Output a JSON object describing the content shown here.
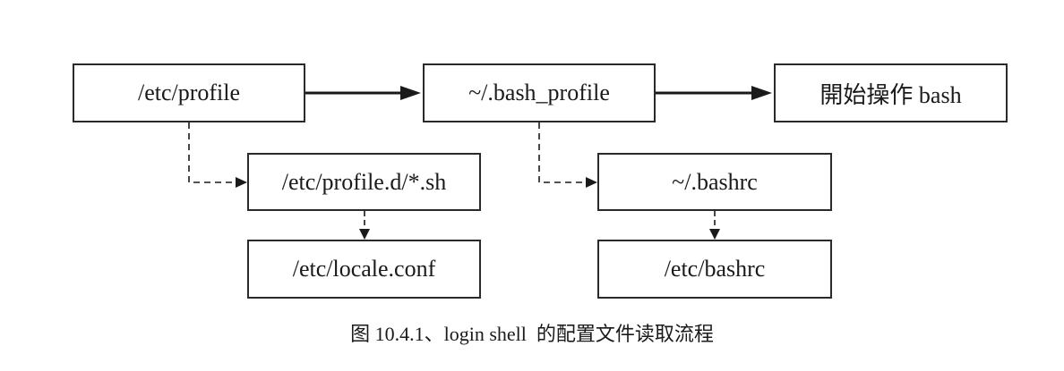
{
  "nodes": {
    "etc_profile": "/etc/profile",
    "bash_profile": "~/.bash_profile",
    "start_bash": "開始操作 bash",
    "profile_d": "/etc/profile.d/*.sh",
    "locale_conf": "/etc/locale.conf",
    "bashrc": "~/.bashrc",
    "etc_bashrc": "/etc/bashrc"
  },
  "caption": {
    "label": "图 10.4.1、login shell  的配置文件读取流程"
  },
  "edges": [
    {
      "from": "/etc/profile",
      "to": "~/.bash_profile",
      "style": "solid"
    },
    {
      "from": "~/.bash_profile",
      "to": "開始操作 bash",
      "style": "solid"
    },
    {
      "from": "/etc/profile",
      "to": "/etc/profile.d/*.sh",
      "style": "dashed"
    },
    {
      "from": "/etc/profile.d/*.sh",
      "to": "/etc/locale.conf",
      "style": "dashed"
    },
    {
      "from": "~/.bash_profile",
      "to": "~/.bashrc",
      "style": "dashed"
    },
    {
      "from": "~/.bashrc",
      "to": "/etc/bashrc",
      "style": "dashed"
    }
  ],
  "colors": {
    "line": "#1a1a1a",
    "box_border": "#2a2a2a",
    "background": "#ffffff"
  }
}
